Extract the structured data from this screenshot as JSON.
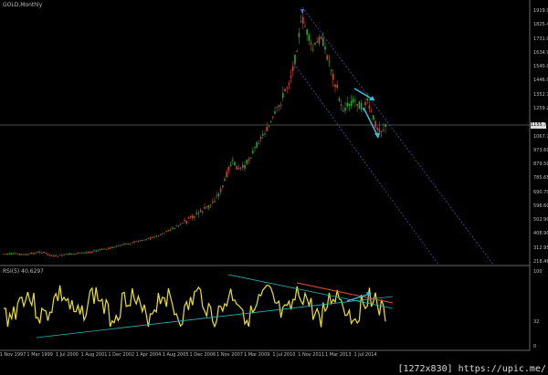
{
  "window": {
    "title": "GOLD,Monthly",
    "indicator_title": "RSI(5) 40.6297",
    "current_price": "1155.72"
  },
  "colors": {
    "background": "#000000",
    "bull_candle": "#1faa2a",
    "bear_candle": "#e23b2a",
    "rsi_line": "#f2e600",
    "trend_line": "#24b6b6",
    "channel_line": "#3a5aa6",
    "resistance_line": "#e0502a",
    "arrow": "#2bc3e6"
  },
  "price_axis": [
    "1919.90",
    "1825.45",
    "1731.00",
    "1634.90",
    "1540.00",
    "1446.00",
    "1352.70",
    "1259.20",
    "1155.72",
    "1067.75",
    "973.60",
    "879.50",
    "785.65",
    "690.70",
    "596.60",
    "502.90",
    "408.90",
    "312.95",
    "218.46"
  ],
  "rsi_axis": [
    "100",
    "32",
    "0"
  ],
  "time_axis": [
    "1 Nov 1997",
    "1 Mar 1999",
    "1 Jul 2000",
    "1 Aug 2001",
    "1 Dec 2002",
    "1 Apr 2004",
    "1 Aug 2005",
    "1 Dec 2006",
    "1 Nov 2007",
    "1 Mar 2009",
    "1 Jul 2010",
    "1 Nov 2011",
    "1 Mar 2013",
    "1 Jul 2014"
  ],
  "watermark": "[1272x830] https://upic.me/"
}
